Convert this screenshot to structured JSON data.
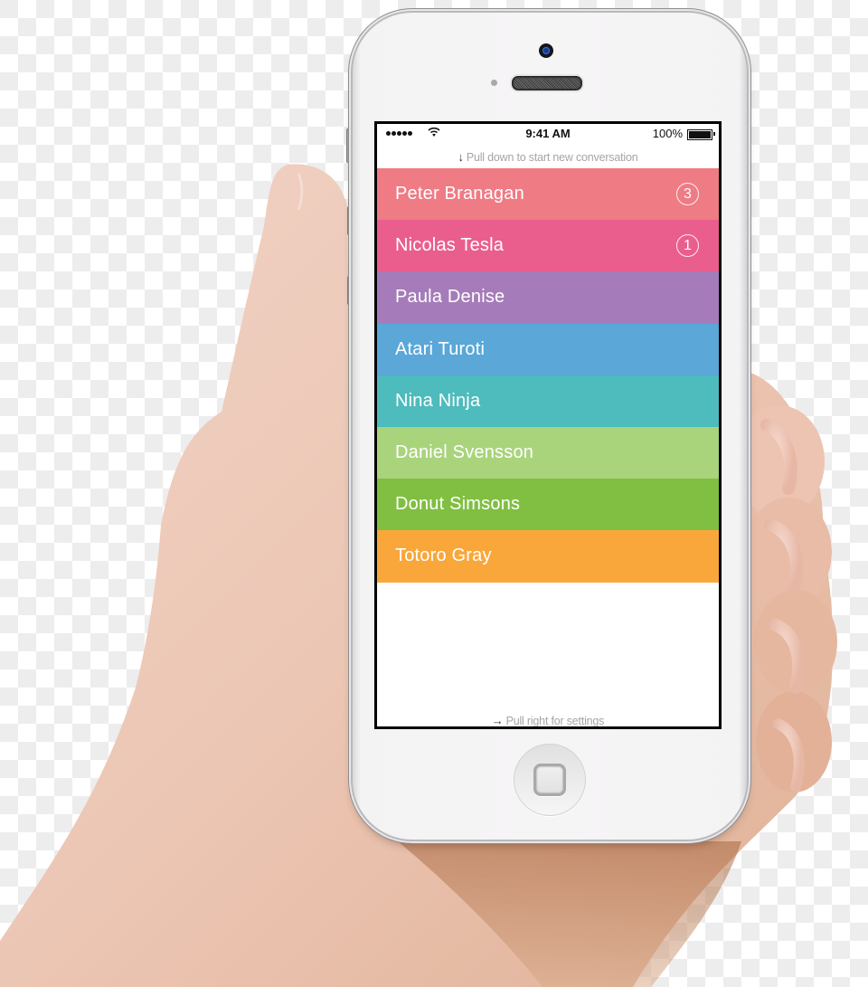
{
  "status_bar": {
    "signal_icon": "signal-dots-icon",
    "wifi_icon": "wifi-icon",
    "time": "9:41 AM",
    "battery_percent": "100%",
    "battery_icon": "battery-full-icon"
  },
  "hints": {
    "top": {
      "icon": "arrow-down-icon",
      "glyph": "↓",
      "text": "Pull down to start new conversation"
    },
    "bottom": {
      "icon": "arrow-right-icon",
      "glyph": "→",
      "text": "Pull right for settings"
    }
  },
  "conversations": [
    {
      "name": "Peter Branagan",
      "unread": "3",
      "color": "#ef7b85"
    },
    {
      "name": "Nicolas Tesla",
      "unread": "1",
      "color": "#ea5e8e"
    },
    {
      "name": "Paula Denise",
      "unread": null,
      "color": "#a57cb9"
    },
    {
      "name": "Atari Turoti",
      "unread": null,
      "color": "#5aa7d8"
    },
    {
      "name": "Nina Ninja",
      "unread": null,
      "color": "#4ebbbd"
    },
    {
      "name": "Daniel Svensson",
      "unread": null,
      "color": "#a9d47c"
    },
    {
      "name": "Donut Simsons",
      "unread": null,
      "color": "#80bf41"
    },
    {
      "name": "Totoro Gray",
      "unread": null,
      "color": "#f9a73b"
    }
  ],
  "device": {
    "camera_icon": "front-camera-icon",
    "speaker_icon": "earpiece-speaker-icon",
    "home_button_icon": "home-button-icon"
  }
}
